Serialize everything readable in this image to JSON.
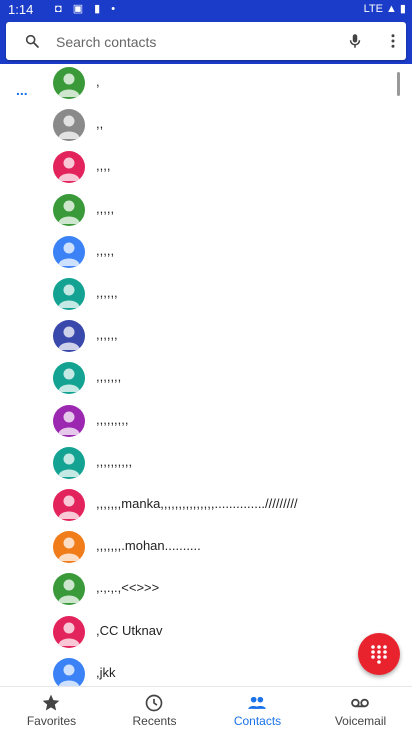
{
  "status_bar": {
    "time": "1:14",
    "network": "LTE"
  },
  "search": {
    "placeholder": "Search contacts"
  },
  "contacts": [
    {
      "name": ",",
      "color": "#3a9a3a"
    },
    {
      "name": ",,",
      "color": "#8a8a8a"
    },
    {
      "name": ",,,,",
      "color": "#e3245c"
    },
    {
      "name": ",,,,,",
      "color": "#3a9a3a"
    },
    {
      "name": ",,,,,",
      "color": "#3b82f6"
    },
    {
      "name": ",,,,,,",
      "color": "#14a392"
    },
    {
      "name": ",,,,,,",
      "color": "#3948ab"
    },
    {
      "name": ",,,,,,,",
      "color": "#14a392"
    },
    {
      "name": ",,,,,,,,,",
      "color": "#9c27b0"
    },
    {
      "name": ",,,,,,,,,,",
      "color": "#14a392"
    },
    {
      "name": ",,,,,,,manka,,,,,,,,,,,,,,,............../////////",
      "color": "#e3245c"
    },
    {
      "name": ",,,,,,,.mohan..........",
      "color": "#f07c1a"
    },
    {
      "name": ",.,.,.,<<>>>",
      "color": "#3a9a3a"
    },
    {
      "name": ",CC Utknav",
      "color": "#e3245c"
    },
    {
      "name": ",jkk",
      "color": "#3b82f6"
    }
  ],
  "bottom_nav": {
    "tabs": [
      {
        "label": "Favorites",
        "icon": "star-icon"
      },
      {
        "label": "Recents",
        "icon": "clock-icon"
      },
      {
        "label": "Contacts",
        "icon": "people-icon"
      },
      {
        "label": "Voicemail",
        "icon": "voicemail-icon"
      }
    ],
    "active": "Contacts",
    "accent": "#1a73e8"
  },
  "fab": {
    "icon": "dialpad-icon",
    "color": "#e8232d"
  },
  "theme": {
    "status_bar": "#1a3cc8"
  }
}
